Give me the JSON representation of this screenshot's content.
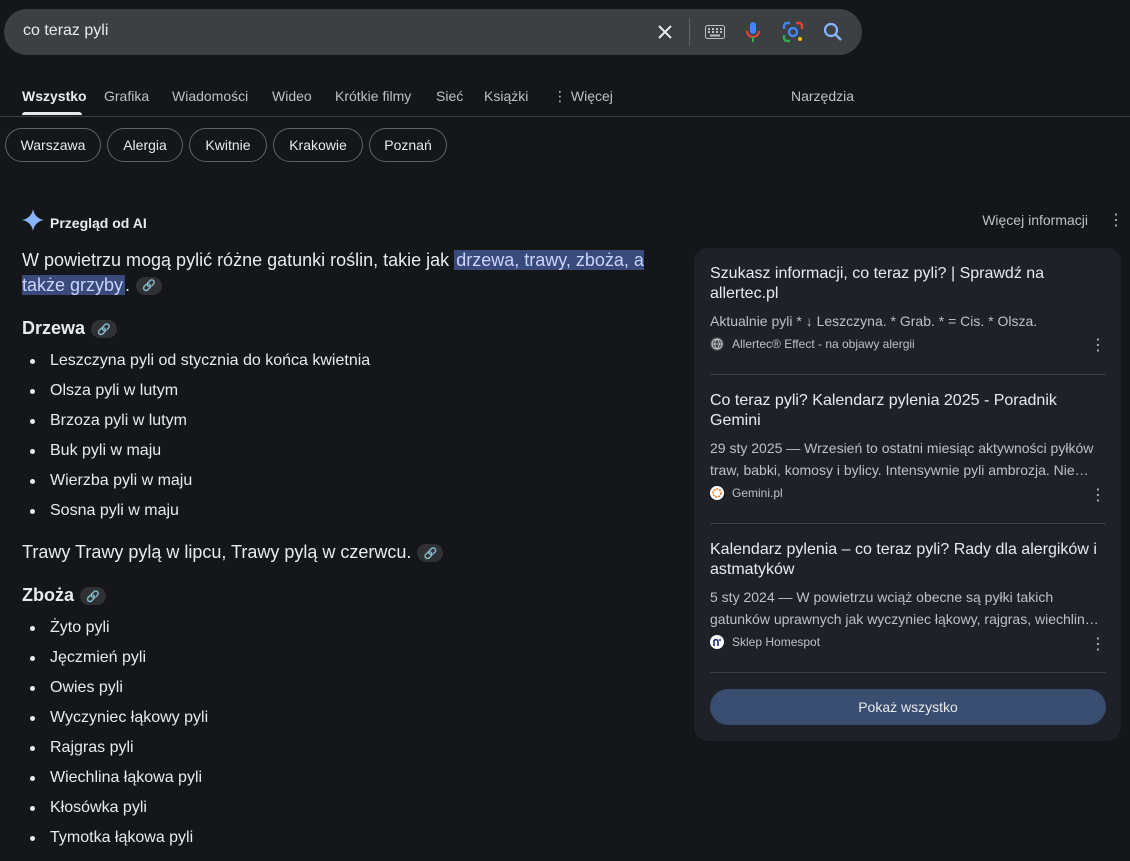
{
  "search": {
    "query": "co teraz pyli"
  },
  "tabs": [
    {
      "label": "Wszystko"
    },
    {
      "label": "Grafika"
    },
    {
      "label": "Wiadomości"
    },
    {
      "label": "Wideo"
    },
    {
      "label": "Krótkie filmy"
    },
    {
      "label": "Sieć"
    },
    {
      "label": "Książki"
    },
    {
      "label": "Więcej"
    },
    {
      "label": "Narzędzia"
    }
  ],
  "chips": [
    "Warszawa",
    "Alergia",
    "Kwitnie",
    "Krakowie",
    "Poznań"
  ],
  "ai": {
    "title": "Przegląd od AI",
    "more_info": "Więcej informacji",
    "intro_prefix": "W powietrzu mogą pylić różne gatunki roślin, takie jak ",
    "intro_highlight": "drzewa, trawy, zboża, a także grzyby",
    "intro_suffix": ".",
    "trees_heading": "Drzewa",
    "trees": [
      "Leszczyna pyli od stycznia do końca kwietnia",
      "Olsza pyli w lutym",
      "Brzoza pyli w lutym",
      "Buk pyli w maju",
      "Wierzba pyli w maju",
      "Sosna pyli w maju"
    ],
    "grasses_text": "Trawy Trawy pylą w lipcu, Trawy pylą w czerwcu.",
    "cereals_heading": "Zboża",
    "cereals": [
      "Żyto pyli",
      "Jęczmień pyli",
      "Owies pyli",
      "Wyczyniec łąkowy pyli",
      "Rajgras pyli",
      "Wiechlina łąkowa pyli",
      "Kłosówka pyli",
      "Tymotka łąkowa pyli"
    ]
  },
  "sources": [
    {
      "title": "Szukasz informacji, co teraz pyli? | Sprawdź na allertec.pl",
      "snippet": "Aktualnie pyli * ↓ Leszczyna. * Grab. * = Cis. * Olsza.",
      "site": "Allertec® Effect - na objawy alergii",
      "icon": "globe-icon"
    },
    {
      "title": "Co teraz pyli? Kalendarz pylenia 2025 - Poradnik Gemini",
      "snippet": "29 sty 2025 — Wrzesień to ostatni miesiąc aktywności pyłków traw, babki, komosy i bylicy. Intensywnie pyli ambrozja. Nie…",
      "site": "Gemini.pl",
      "icon": "gemini-icon"
    },
    {
      "title": "Kalendarz pylenia – co teraz pyli? Rady dla alergików i astmatyków",
      "snippet": "5 sty 2024 — W powietrzu wciąż obecne są pyłki takich gatunków uprawnych jak wyczyniec łąkowy, rajgras, wiechlin…",
      "site": "Sklep Homespot",
      "icon": "homespot-icon"
    }
  ],
  "show_all": "Pokaż wszystko",
  "colors": {
    "background": "#141619",
    "highlight": "#3a4a7a",
    "show_all_button": "#394d70",
    "ai_sparkle": "#8ab4f8"
  }
}
